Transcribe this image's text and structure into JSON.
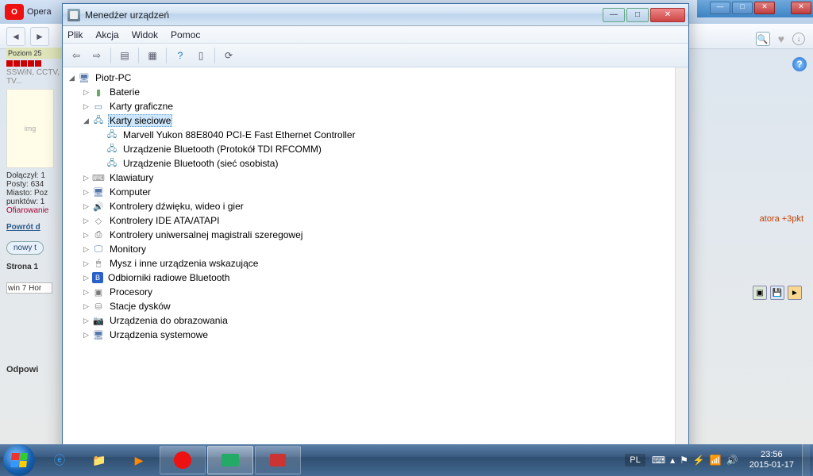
{
  "browser": {
    "name": "Opera",
    "level_label": "Poziom 25",
    "tags": "SSWiN, CCTV, TV...",
    "joined": "Dołączył: 1",
    "posts": "Posty: 634",
    "city": "Miasto: Poz",
    "points": "punktów: 1",
    "donation": "Ofiarowanie",
    "back_link": "Powrót d",
    "new_topic": "nowy t",
    "page": "Strona 1",
    "textarea": "win 7 Hor",
    "reply": "Odpowi",
    "right_hint": "atora +3pkt"
  },
  "devmgr": {
    "title": "Menedżer urządzeń",
    "menu": {
      "file": "Plik",
      "action": "Akcja",
      "view": "Widok",
      "help": "Pomoc"
    },
    "root": "Piotr-PC",
    "nodes": {
      "batteries": "Baterie",
      "display_adapters": "Karty graficzne",
      "network_adapters": "Karty sieciowe",
      "net_children": [
        "Marvell Yukon 88E8040 PCI-E Fast Ethernet Controller",
        "Urządzenie Bluetooth (Protokół TDI RFCOMM)",
        "Urządzenie Bluetooth (sieć osobista)"
      ],
      "keyboards": "Klawiatury",
      "computer": "Komputer",
      "sound": "Kontrolery dźwięku, wideo i gier",
      "ide": "Kontrolery IDE ATA/ATAPI",
      "usb": "Kontrolery uniwersalnej magistrali szeregowej",
      "monitors": "Monitory",
      "mice": "Mysz i inne urządzenia wskazujące",
      "bt": "Odbiorniki radiowe Bluetooth",
      "cpu": "Procesory",
      "disk": "Stacje dysków",
      "imaging": "Urządzenia do obrazowania",
      "system": "Urządzenia systemowe"
    }
  },
  "taskbar": {
    "lang": "PL",
    "time": "23:56",
    "date": "2015-01-17"
  }
}
